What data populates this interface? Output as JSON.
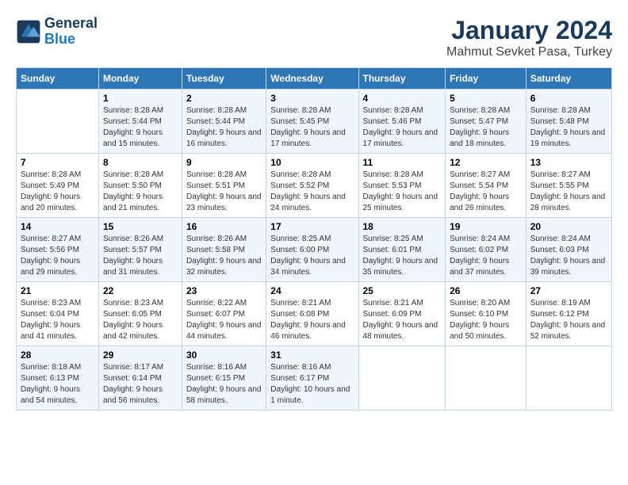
{
  "logo": {
    "text_general": "General",
    "text_blue": "Blue"
  },
  "title": "January 2024",
  "subtitle": "Mahmut Sevket Pasa, Turkey",
  "days_of_week": [
    "Sunday",
    "Monday",
    "Tuesday",
    "Wednesday",
    "Thursday",
    "Friday",
    "Saturday"
  ],
  "weeks": [
    [
      {
        "day": "",
        "sunrise": "",
        "sunset": "",
        "daylight": ""
      },
      {
        "day": "1",
        "sunrise": "Sunrise: 8:28 AM",
        "sunset": "Sunset: 5:44 PM",
        "daylight": "Daylight: 9 hours and 15 minutes."
      },
      {
        "day": "2",
        "sunrise": "Sunrise: 8:28 AM",
        "sunset": "Sunset: 5:44 PM",
        "daylight": "Daylight: 9 hours and 16 minutes."
      },
      {
        "day": "3",
        "sunrise": "Sunrise: 8:28 AM",
        "sunset": "Sunset: 5:45 PM",
        "daylight": "Daylight: 9 hours and 17 minutes."
      },
      {
        "day": "4",
        "sunrise": "Sunrise: 8:28 AM",
        "sunset": "Sunset: 5:46 PM",
        "daylight": "Daylight: 9 hours and 17 minutes."
      },
      {
        "day": "5",
        "sunrise": "Sunrise: 8:28 AM",
        "sunset": "Sunset: 5:47 PM",
        "daylight": "Daylight: 9 hours and 18 minutes."
      },
      {
        "day": "6",
        "sunrise": "Sunrise: 8:28 AM",
        "sunset": "Sunset: 5:48 PM",
        "daylight": "Daylight: 9 hours and 19 minutes."
      }
    ],
    [
      {
        "day": "7",
        "sunrise": "Sunrise: 8:28 AM",
        "sunset": "Sunset: 5:49 PM",
        "daylight": "Daylight: 9 hours and 20 minutes."
      },
      {
        "day": "8",
        "sunrise": "Sunrise: 8:28 AM",
        "sunset": "Sunset: 5:50 PM",
        "daylight": "Daylight: 9 hours and 21 minutes."
      },
      {
        "day": "9",
        "sunrise": "Sunrise: 8:28 AM",
        "sunset": "Sunset: 5:51 PM",
        "daylight": "Daylight: 9 hours and 23 minutes."
      },
      {
        "day": "10",
        "sunrise": "Sunrise: 8:28 AM",
        "sunset": "Sunset: 5:52 PM",
        "daylight": "Daylight: 9 hours and 24 minutes."
      },
      {
        "day": "11",
        "sunrise": "Sunrise: 8:28 AM",
        "sunset": "Sunset: 5:53 PM",
        "daylight": "Daylight: 9 hours and 25 minutes."
      },
      {
        "day": "12",
        "sunrise": "Sunrise: 8:27 AM",
        "sunset": "Sunset: 5:54 PM",
        "daylight": "Daylight: 9 hours and 26 minutes."
      },
      {
        "day": "13",
        "sunrise": "Sunrise: 8:27 AM",
        "sunset": "Sunset: 5:55 PM",
        "daylight": "Daylight: 9 hours and 28 minutes."
      }
    ],
    [
      {
        "day": "14",
        "sunrise": "Sunrise: 8:27 AM",
        "sunset": "Sunset: 5:56 PM",
        "daylight": "Daylight: 9 hours and 29 minutes."
      },
      {
        "day": "15",
        "sunrise": "Sunrise: 8:26 AM",
        "sunset": "Sunset: 5:57 PM",
        "daylight": "Daylight: 9 hours and 31 minutes."
      },
      {
        "day": "16",
        "sunrise": "Sunrise: 8:26 AM",
        "sunset": "Sunset: 5:58 PM",
        "daylight": "Daylight: 9 hours and 32 minutes."
      },
      {
        "day": "17",
        "sunrise": "Sunrise: 8:25 AM",
        "sunset": "Sunset: 6:00 PM",
        "daylight": "Daylight: 9 hours and 34 minutes."
      },
      {
        "day": "18",
        "sunrise": "Sunrise: 8:25 AM",
        "sunset": "Sunset: 6:01 PM",
        "daylight": "Daylight: 9 hours and 35 minutes."
      },
      {
        "day": "19",
        "sunrise": "Sunrise: 8:24 AM",
        "sunset": "Sunset: 6:02 PM",
        "daylight": "Daylight: 9 hours and 37 minutes."
      },
      {
        "day": "20",
        "sunrise": "Sunrise: 8:24 AM",
        "sunset": "Sunset: 6:03 PM",
        "daylight": "Daylight: 9 hours and 39 minutes."
      }
    ],
    [
      {
        "day": "21",
        "sunrise": "Sunrise: 8:23 AM",
        "sunset": "Sunset: 6:04 PM",
        "daylight": "Daylight: 9 hours and 41 minutes."
      },
      {
        "day": "22",
        "sunrise": "Sunrise: 8:23 AM",
        "sunset": "Sunset: 6:05 PM",
        "daylight": "Daylight: 9 hours and 42 minutes."
      },
      {
        "day": "23",
        "sunrise": "Sunrise: 8:22 AM",
        "sunset": "Sunset: 6:07 PM",
        "daylight": "Daylight: 9 hours and 44 minutes."
      },
      {
        "day": "24",
        "sunrise": "Sunrise: 8:21 AM",
        "sunset": "Sunset: 6:08 PM",
        "daylight": "Daylight: 9 hours and 46 minutes."
      },
      {
        "day": "25",
        "sunrise": "Sunrise: 8:21 AM",
        "sunset": "Sunset: 6:09 PM",
        "daylight": "Daylight: 9 hours and 48 minutes."
      },
      {
        "day": "26",
        "sunrise": "Sunrise: 8:20 AM",
        "sunset": "Sunset: 6:10 PM",
        "daylight": "Daylight: 9 hours and 50 minutes."
      },
      {
        "day": "27",
        "sunrise": "Sunrise: 8:19 AM",
        "sunset": "Sunset: 6:12 PM",
        "daylight": "Daylight: 9 hours and 52 minutes."
      }
    ],
    [
      {
        "day": "28",
        "sunrise": "Sunrise: 8:18 AM",
        "sunset": "Sunset: 6:13 PM",
        "daylight": "Daylight: 9 hours and 54 minutes."
      },
      {
        "day": "29",
        "sunrise": "Sunrise: 8:17 AM",
        "sunset": "Sunset: 6:14 PM",
        "daylight": "Daylight: 9 hours and 56 minutes."
      },
      {
        "day": "30",
        "sunrise": "Sunrise: 8:16 AM",
        "sunset": "Sunset: 6:15 PM",
        "daylight": "Daylight: 9 hours and 58 minutes."
      },
      {
        "day": "31",
        "sunrise": "Sunrise: 8:16 AM",
        "sunset": "Sunset: 6:17 PM",
        "daylight": "Daylight: 10 hours and 1 minute."
      },
      {
        "day": "",
        "sunrise": "",
        "sunset": "",
        "daylight": ""
      },
      {
        "day": "",
        "sunrise": "",
        "sunset": "",
        "daylight": ""
      },
      {
        "day": "",
        "sunrise": "",
        "sunset": "",
        "daylight": ""
      }
    ]
  ]
}
